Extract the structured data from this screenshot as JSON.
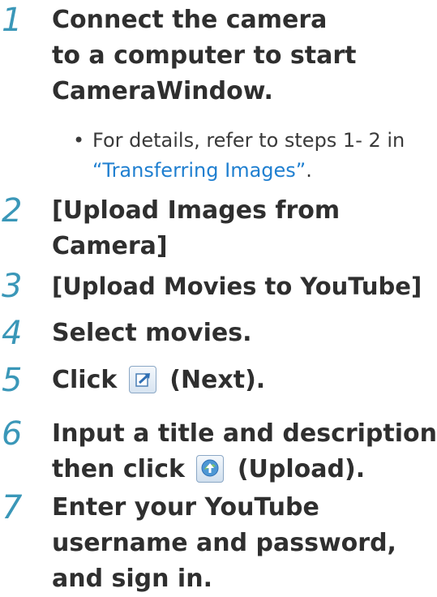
{
  "steps": [
    {
      "num": "1",
      "lines": [
        "Connect the camera",
        "to a computer to start",
        "CameraWindow."
      ]
    },
    {
      "num": "2",
      "lines": [
        "[Upload Images from",
        "Camera]"
      ]
    },
    {
      "num": "3",
      "lines": [
        "[Upload Movies to YouTube]"
      ]
    },
    {
      "num": "4",
      "lines": [
        "Select movies."
      ]
    },
    {
      "num": "5",
      "before": "Click",
      "after": "(Next)."
    },
    {
      "num": "6",
      "line1": "Input a title and description,",
      "before": "then click",
      "after": "(Upload)."
    },
    {
      "num": "7",
      "lines": [
        "Enter your YouTube",
        "username and password,",
        "and sign in."
      ]
    }
  ],
  "note": {
    "bullet": "•",
    "text": "For details, refer to steps 1- 2 in",
    "link": "“Transferring Images”",
    "after": "."
  },
  "icons": {
    "next": "next-icon",
    "upload": "upload-icon"
  },
  "colors": {
    "step_number": "#3a97b8",
    "link": "#1f7fd0",
    "text": "#2f2f2f"
  }
}
